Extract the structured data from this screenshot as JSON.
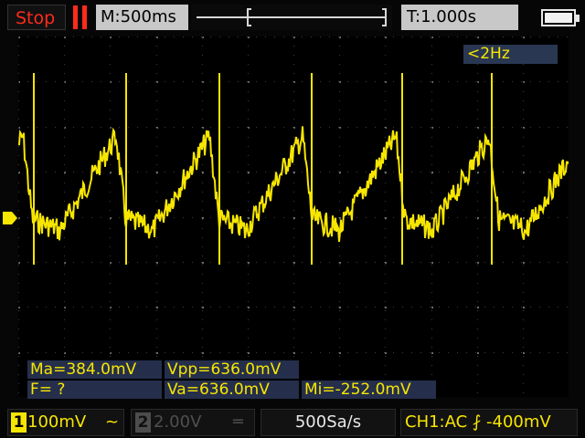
{
  "header": {
    "run_state": "Stop",
    "timebase": "M:500ms",
    "trigger_time": "T:1.000s"
  },
  "screen": {
    "frequency_readout": "<2Hz",
    "trace_color": "#f7e600"
  },
  "measurements": {
    "max": "Ma=384.0mV",
    "vpp": "Vpp=636.0mV",
    "freq": "F=  ?",
    "avg": "Va=636.0mV",
    "min": "Mi=-252.0mV"
  },
  "status_bar": {
    "ch1_number": "1",
    "ch1_scale": "100mV",
    "ch1_coupling_icon": "~",
    "ch2_number": "2",
    "ch2_scale": "2.00V",
    "ch2_coupling_icon": "═",
    "sample_rate": "500Sa/s",
    "trigger": "CH1:AC ⨏ -400mV"
  },
  "icons": {
    "pause": "pause-icon",
    "battery": "battery-icon",
    "trigger_level": "trigger-level-marker"
  }
}
